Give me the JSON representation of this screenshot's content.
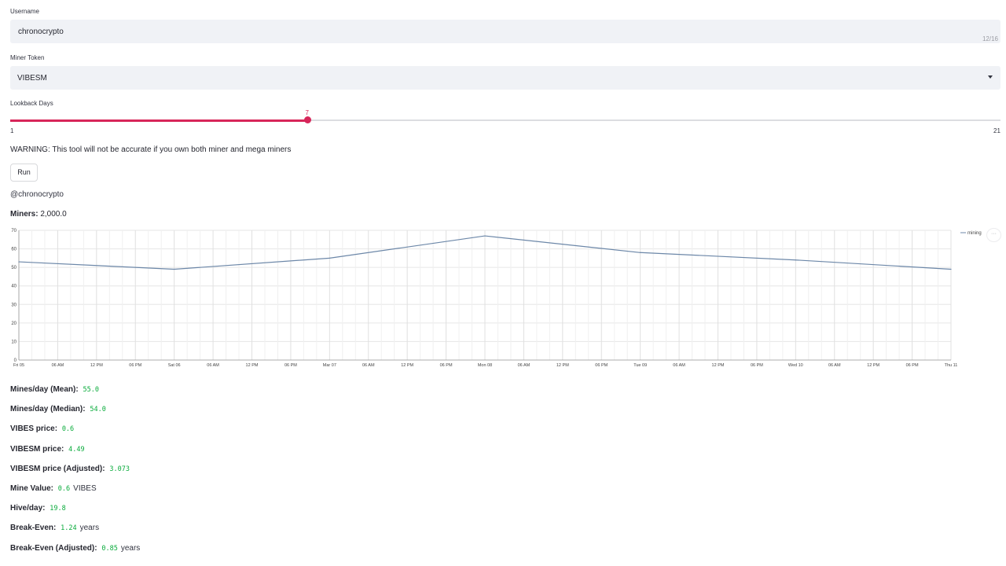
{
  "form": {
    "username_label": "Username",
    "username_value": "chronocrypto",
    "username_counter": "12/16",
    "token_label": "Miner Token",
    "token_value": "VIBESM",
    "lookback_label": "Lookback Days",
    "lookback_value": "7",
    "lookback_min": "1",
    "lookback_max": "21",
    "lookback_fraction": 0.3,
    "warning": "WARNING: This tool will not be accurate if you own both miner and mega miners",
    "run_label": "Run"
  },
  "accent_color": "#d7265a",
  "value_color": "#09ab3b",
  "result": {
    "handle": "@chronocrypto",
    "miners_label": "Miners:",
    "miners_value": "2,000.0"
  },
  "chart_data": {
    "type": "line",
    "x_tick_labels": [
      "Fri 05",
      "06 AM",
      "12 PM",
      "06 PM",
      "Sat 06",
      "06 AM",
      "12 PM",
      "06 PM",
      "Mar 07",
      "06 AM",
      "12 PM",
      "06 PM",
      "Mon 08",
      "06 AM",
      "12 PM",
      "06 PM",
      "Tue 09",
      "06 AM",
      "12 PM",
      "06 PM",
      "Wed 10",
      "06 AM",
      "12 PM",
      "06 PM",
      "Thu 11"
    ],
    "y_ticks": [
      "0",
      "10",
      "20",
      "30",
      "40",
      "50",
      "60",
      "70"
    ],
    "ylim": [
      0,
      70
    ],
    "grid": true,
    "legend_position": "top-right",
    "line_color": "#6c87a8",
    "series": [
      {
        "name": "mining",
        "points": [
          {
            "x": "Fri 05",
            "y": 53
          },
          {
            "x": "Sat 06",
            "y": 49
          },
          {
            "x": "Mar 07",
            "y": 55
          },
          {
            "x": "Mon 08",
            "y": 67
          },
          {
            "x": "Tue 09",
            "y": 58
          },
          {
            "x": "Wed 10",
            "y": 54
          },
          {
            "x": "Thu 11",
            "y": 49
          }
        ]
      }
    ]
  },
  "metrics": [
    {
      "label": "Mines/day (Mean):",
      "value": "55.0",
      "unit": ""
    },
    {
      "label": "Mines/day (Median):",
      "value": "54.0",
      "unit": ""
    },
    {
      "label": "VIBES price:",
      "value": "0.6",
      "unit": ""
    },
    {
      "label": "VIBESM price:",
      "value": "4.49",
      "unit": ""
    },
    {
      "label": "VIBESM price (Adjusted):",
      "value": "3.073",
      "unit": ""
    },
    {
      "label": "Mine Value:",
      "value": "0.6",
      "unit": "VIBES"
    },
    {
      "label": "Hive/day:",
      "value": "19.8",
      "unit": ""
    },
    {
      "label": "Break-Even:",
      "value": "1.24",
      "unit": "years"
    },
    {
      "label": "Break-Even (Adjusted):",
      "value": "0.85",
      "unit": "years"
    }
  ],
  "icons": {
    "dropdown": "chevron-down-icon",
    "chart_menu": "more-horizontal-icon"
  }
}
